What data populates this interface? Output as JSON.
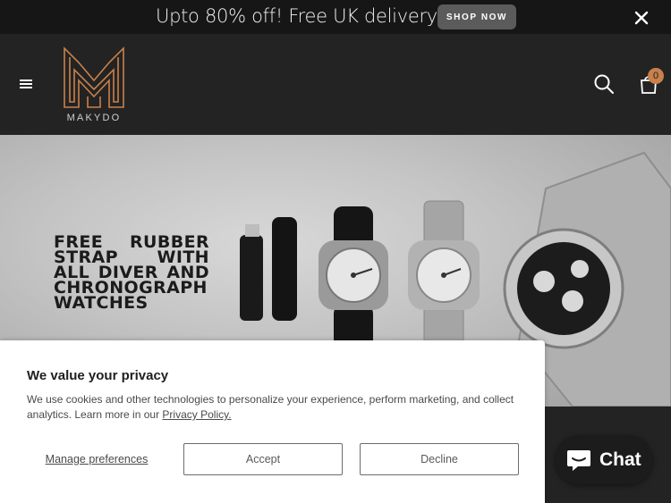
{
  "announcement": {
    "text": "Upto 80% off! Free UK delivery",
    "button": "SHOP NOW"
  },
  "header": {
    "logo_text": "MAKYDO",
    "cart_count": "0",
    "icons": [
      "menu-icon",
      "search-icon",
      "cart-icon",
      "close-icon"
    ]
  },
  "hero": {
    "headline": "FREE RUBBER STRAP WITH ALL DIVER AND CHRONOGRAPH WATCHES"
  },
  "cookie": {
    "title": "We value your privacy",
    "body": "We use cookies and other technologies to personalize your experience, perform marketing, and collect analytics. Learn more in our",
    "link": "Privacy Policy.",
    "manage": "Manage preferences",
    "accept": "Accept",
    "decline": "Decline"
  },
  "chat": {
    "label": "Chat"
  },
  "colors": {
    "accent": "#c8814c",
    "dark": "#232323",
    "announce_bg": "#161616"
  }
}
